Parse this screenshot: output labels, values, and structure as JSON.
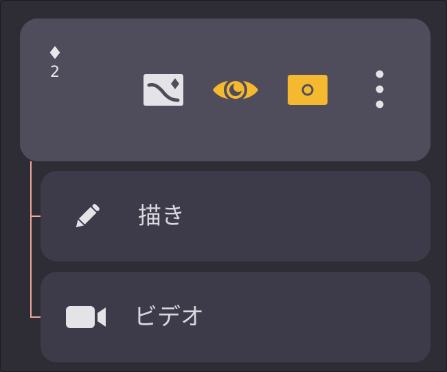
{
  "layer": {
    "badge_symbol": "♦",
    "badge_number": "2",
    "tools": [
      {
        "icon": "image-mask-icon",
        "active": false
      },
      {
        "icon": "eye-icon",
        "active": true,
        "color": "#f4b92e"
      },
      {
        "icon": "camera-record-icon",
        "active": true,
        "color": "#f4b92e"
      },
      {
        "icon": "more-vertical-icon"
      }
    ]
  },
  "children": [
    {
      "icon": "pencil-icon",
      "label": "描き"
    },
    {
      "icon": "video-camera-icon",
      "label": "ビデオ"
    }
  ],
  "colors": {
    "accent": "#f4b92e",
    "connector": "#f0a89a",
    "card": "#4f4d5c",
    "child_card": "#3d3b4a",
    "background": "#2e2c35"
  }
}
